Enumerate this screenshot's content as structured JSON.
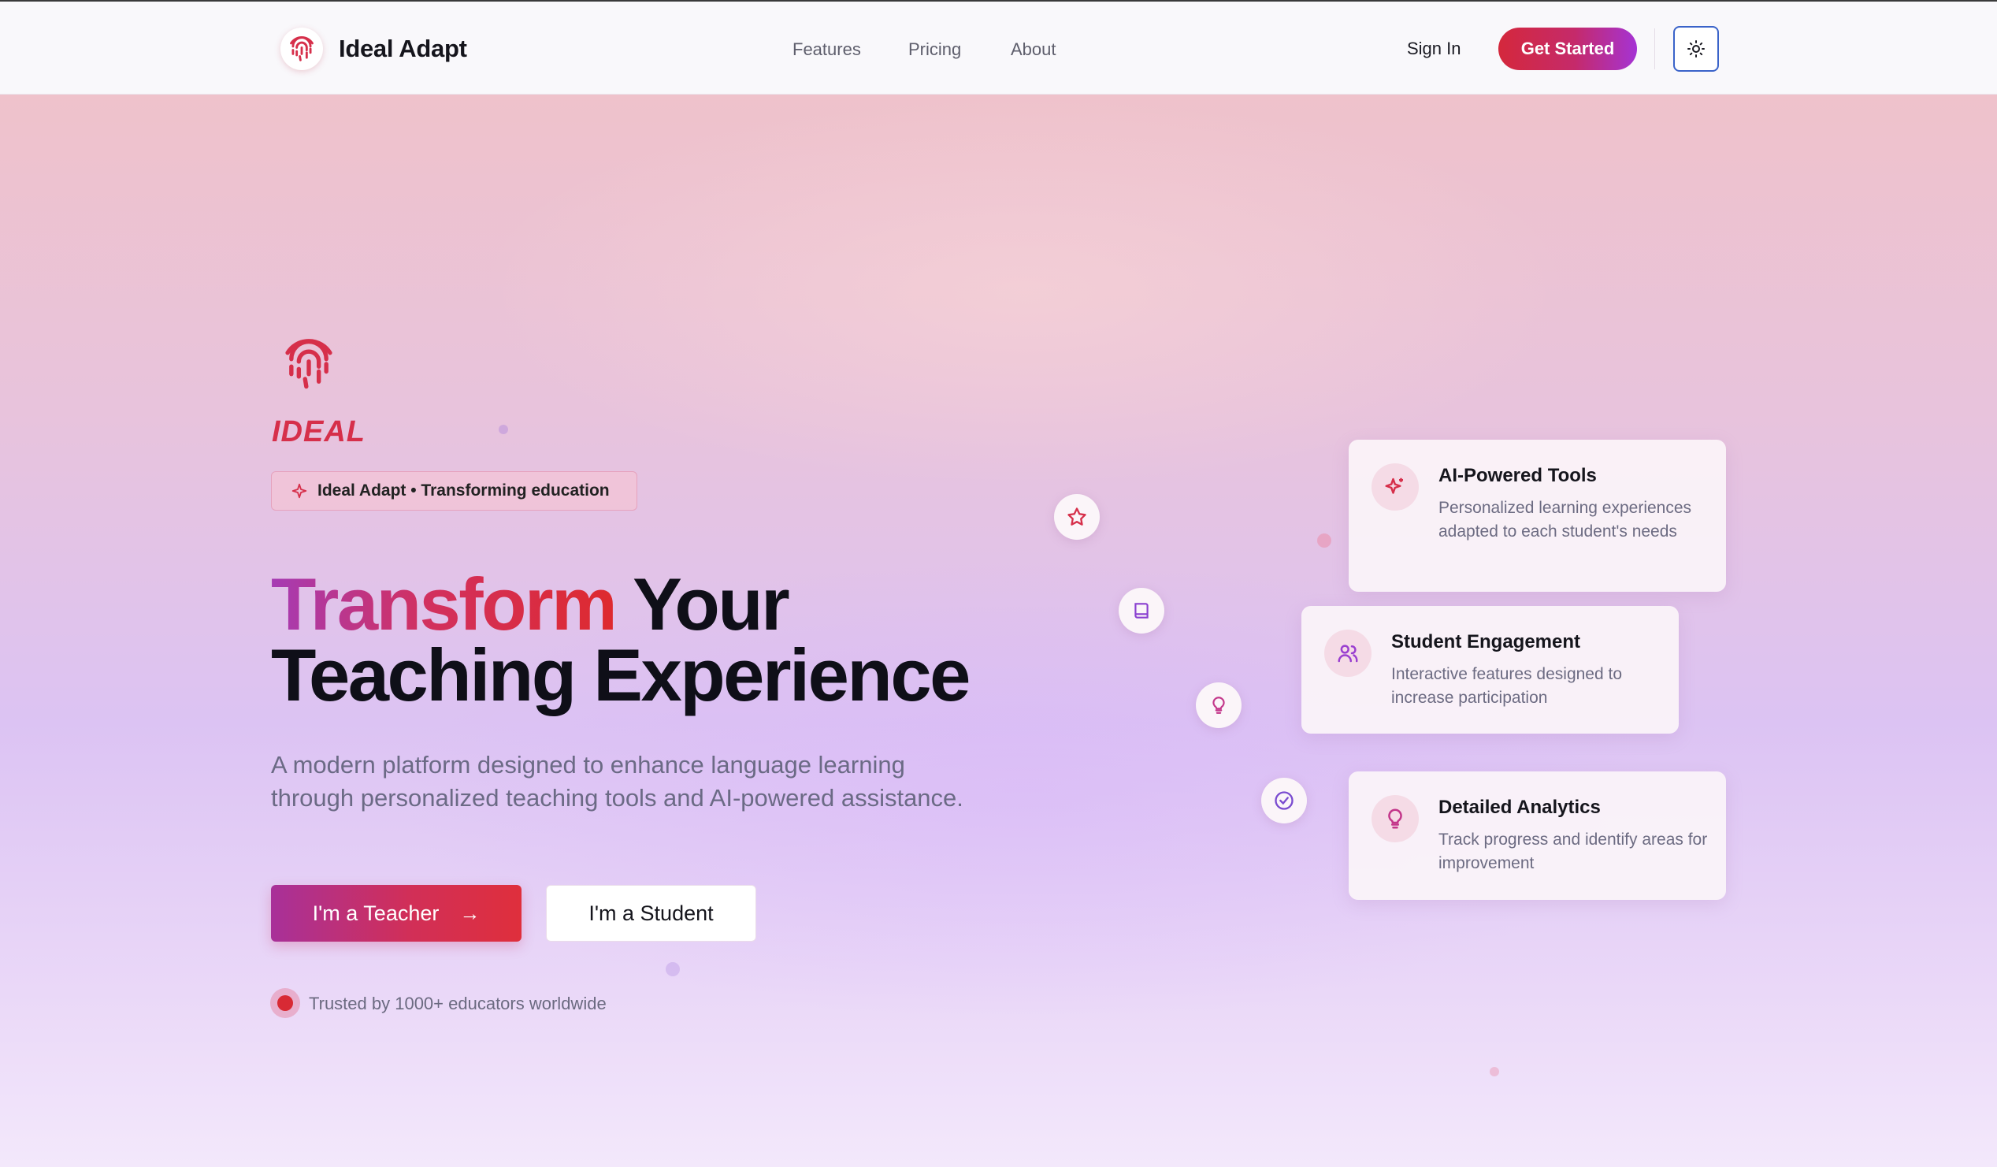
{
  "header": {
    "brand": "Ideal Adapt",
    "nav": [
      "Features",
      "Pricing",
      "About"
    ],
    "sign_in": "Sign In",
    "get_started": "Get Started"
  },
  "hero": {
    "logo_word": "IDEAL",
    "pill": "Ideal Adapt • Transforming education",
    "title_highlight": "Transform",
    "title_rest_line1": " Your",
    "title_line2": "Teaching Experience",
    "subtitle": "A modern platform designed to enhance language learning through personalized teaching tools and AI-powered assistance.",
    "teacher_button": "I'm a Teacher",
    "student_button": "I'm a Student",
    "trust": "Trusted by 1000+ educators worldwide"
  },
  "features": [
    {
      "title": "AI-Powered Tools",
      "desc": "Personalized learning experiences adapted to each student's needs",
      "icon": "sparkle-icon"
    },
    {
      "title": "Student Engagement",
      "desc": "Interactive features designed to increase participation",
      "icon": "users-icon"
    },
    {
      "title": "Detailed Analytics",
      "desc": "Track progress and identify areas for improvement",
      "icon": "lightbulb-icon"
    }
  ],
  "floating_icons": [
    "star-icon",
    "book-icon",
    "lightbulb-icon",
    "check-circle-icon"
  ],
  "colors": {
    "accent_red": "#d62f4a",
    "accent_purple": "#a533d4",
    "theme_button_border": "#3a63c9"
  }
}
